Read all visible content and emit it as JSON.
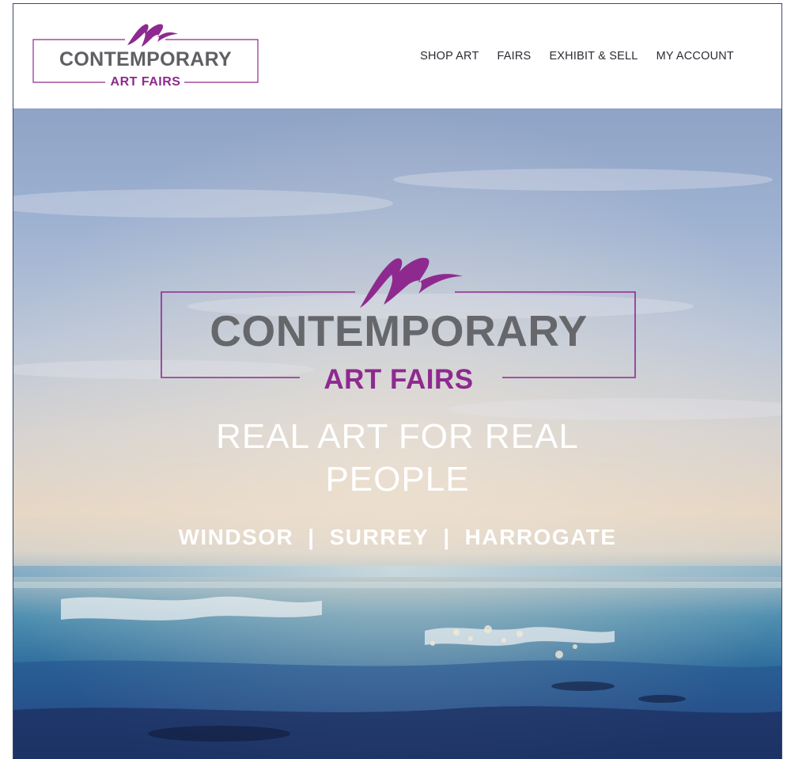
{
  "header": {
    "logo": {
      "line1": "CONTEMPORARY",
      "line2": "ART FAIRS"
    },
    "nav": [
      {
        "label": "SHOP ART"
      },
      {
        "label": "FAIRS"
      },
      {
        "label": "EXHIBIT & SELL"
      },
      {
        "label": "MY ACCOUNT"
      }
    ]
  },
  "hero": {
    "logo": {
      "line1": "CONTEMPORARY",
      "line2": "ART FAIRS"
    },
    "tagline_line1": "REAL ART FOR REAL",
    "tagline_line2": "PEOPLE",
    "locations": [
      "WINDSOR",
      "SURREY",
      "HARROGATE"
    ],
    "separator": "|"
  },
  "colors": {
    "brand_purple": "#8e2a8f",
    "logo_grey": "#66676b",
    "nav_text": "#2b2b33"
  }
}
